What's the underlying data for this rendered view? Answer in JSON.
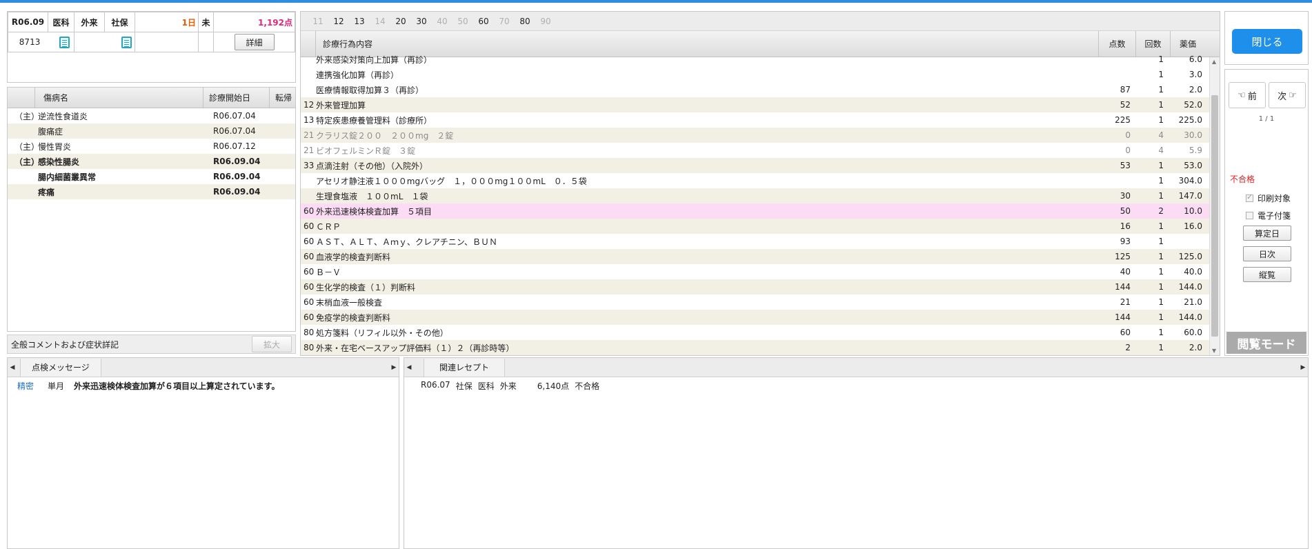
{
  "header": {
    "month": "R06.09",
    "dept": "医科",
    "type": "外来",
    "insurer": "社保",
    "days": "1日",
    "status_char": "未",
    "points": "1,192点",
    "patient_no": "8713",
    "detail_label": "詳細"
  },
  "diseases": {
    "columns": [
      "傷病名",
      "診療開始日",
      "転帰"
    ],
    "rows": [
      {
        "mark": "（主）",
        "name": "逆流性食道炎",
        "date": "R06.07.04",
        "outcome": "",
        "bold": false
      },
      {
        "mark": "",
        "name": "腹痛症",
        "date": "R06.07.04",
        "outcome": "",
        "bold": false
      },
      {
        "mark": "（主）",
        "name": "慢性胃炎",
        "date": "R06.07.12",
        "outcome": "",
        "bold": false
      },
      {
        "mark": "（主）",
        "name": "感染性腸炎",
        "date": "R06.09.04",
        "outcome": "",
        "bold": true
      },
      {
        "mark": "",
        "name": "腸内細菌叢異常",
        "date": "R06.09.04",
        "outcome": "",
        "bold": true
      },
      {
        "mark": "",
        "name": "疼痛",
        "date": "R06.09.04",
        "outcome": "",
        "bold": true
      }
    ]
  },
  "comment": {
    "label": "全般コメントおよび症状詳記",
    "expand_label": "拡大"
  },
  "main": {
    "category_tabs": [
      {
        "label": "11",
        "active": false
      },
      {
        "label": "12",
        "active": true
      },
      {
        "label": "13",
        "active": true
      },
      {
        "label": "14",
        "active": false
      },
      {
        "label": "20",
        "active": true
      },
      {
        "label": "30",
        "active": true
      },
      {
        "label": "40",
        "active": false
      },
      {
        "label": "50",
        "active": false
      },
      {
        "label": "60",
        "active": true
      },
      {
        "label": "70",
        "active": false
      },
      {
        "label": "80",
        "active": true
      },
      {
        "label": "90",
        "active": false
      }
    ],
    "columns": {
      "content": "診療行為内容",
      "points": "点数",
      "count": "回数",
      "price": "薬価"
    },
    "rows": [
      {
        "code": "",
        "name": "外来感染対策向上加算（再診）",
        "points": "",
        "count": "1",
        "price": "6.0",
        "style": "",
        "indent": true
      },
      {
        "code": "",
        "name": "連携強化加算（再診）",
        "points": "",
        "count": "1",
        "price": "3.0",
        "style": "",
        "indent": true
      },
      {
        "code": "",
        "name": "医療情報取得加算３（再診）",
        "points": "87",
        "count": "1",
        "price": "2.0",
        "style": "",
        "indent": true
      },
      {
        "code": "12",
        "name": "外来管理加算",
        "points": "52",
        "count": "1",
        "price": "52.0",
        "style": "alt",
        "indent": false
      },
      {
        "code": "13",
        "name": "特定疾患療養管理料（診療所）",
        "points": "225",
        "count": "1",
        "price": "225.0",
        "style": "",
        "indent": false
      },
      {
        "code": "21",
        "name": "クラリス錠２００　２００mg　２錠",
        "points": "0",
        "count": "4",
        "price": "30.0",
        "style": "alt gray",
        "indent": false
      },
      {
        "code": "21",
        "name": "ビオフェルミンＲ錠　３錠",
        "points": "0",
        "count": "4",
        "price": "5.9",
        "style": "gray",
        "indent": false
      },
      {
        "code": "33",
        "name": "点滴注射（その他）（入院外）",
        "points": "53",
        "count": "1",
        "price": "53.0",
        "style": "alt",
        "indent": false
      },
      {
        "code": "",
        "name": "アセリオ静注液１０００mgバッグ　１，０００mg１００mL　０．５袋",
        "points": "",
        "count": "1",
        "price": "304.0",
        "style": "",
        "indent": true
      },
      {
        "code": "",
        "name": "生理食塩液　１００mL　１袋",
        "points": "30",
        "count": "1",
        "price": "147.0",
        "style": "alt",
        "indent": true
      },
      {
        "code": "60",
        "name": "外来迅速検体検査加算　５項目",
        "points": "50",
        "count": "2",
        "price": "10.0",
        "style": "pinkrow",
        "indent": false
      },
      {
        "code": "60",
        "name": "ＣＲＰ",
        "points": "16",
        "count": "1",
        "price": "16.0",
        "style": "alt",
        "indent": false
      },
      {
        "code": "60",
        "name": "ＡＳＴ、ＡＬＴ、Ａｍｙ、クレアチニン、ＢＵＮ",
        "points": "93",
        "count": "1",
        "price": "",
        "style": "",
        "indent": false
      },
      {
        "code": "60",
        "name": "血液学的検査判断料",
        "points": "125",
        "count": "1",
        "price": "125.0",
        "style": "alt",
        "indent": false
      },
      {
        "code": "60",
        "name": "Ｂ－Ｖ",
        "points": "40",
        "count": "1",
        "price": "40.0",
        "style": "",
        "indent": false
      },
      {
        "code": "60",
        "name": "生化学的検査（１）判断料",
        "points": "144",
        "count": "1",
        "price": "144.0",
        "style": "alt",
        "indent": false
      },
      {
        "code": "60",
        "name": "末梢血液一般検査",
        "points": "21",
        "count": "1",
        "price": "21.0",
        "style": "",
        "indent": false
      },
      {
        "code": "60",
        "name": "免疫学的検査判断料",
        "points": "144",
        "count": "1",
        "price": "144.0",
        "style": "alt",
        "indent": false
      },
      {
        "code": "80",
        "name": "処方箋料（リフィル以外・その他）",
        "points": "60",
        "count": "1",
        "price": "60.0",
        "style": "",
        "indent": false
      },
      {
        "code": "80",
        "name": "外来・在宅ベースアップ評価料（１）２（再診時等）",
        "points": "2",
        "count": "1",
        "price": "2.0",
        "style": "alt",
        "indent": false
      }
    ]
  },
  "right": {
    "close_label": "閉じる",
    "prev_label": "前",
    "next_label": "次",
    "page": "1 / 1",
    "result": "不合格",
    "print_target_label": "印刷対象",
    "print_target_checked": true,
    "e_tag_label": "電子付箋",
    "e_tag_checked": false,
    "calc_day_label": "算定日",
    "daily_label": "日次",
    "vertical_label": "縦覧",
    "mode_label": "閲覧モード"
  },
  "check": {
    "tab_label": "点検メッセージ",
    "messages": [
      {
        "level": "精密",
        "scope": "単月",
        "text": "外来迅速検体検査加算が６項目以上算定されています。"
      }
    ]
  },
  "related": {
    "tab_label": "関連レセプト",
    "items": [
      {
        "month": "R06.07",
        "insurer": "社保",
        "dept": "医科",
        "type": "外来",
        "points": "6,140点",
        "result": "不合格"
      }
    ]
  },
  "colors": {
    "accent": "#1e8fea",
    "orange": "#ee5a00",
    "pink": "#e0287a",
    "fail": "#e02020",
    "highlight": "#fcdcf4",
    "alt_row": "#f2f0e4"
  }
}
